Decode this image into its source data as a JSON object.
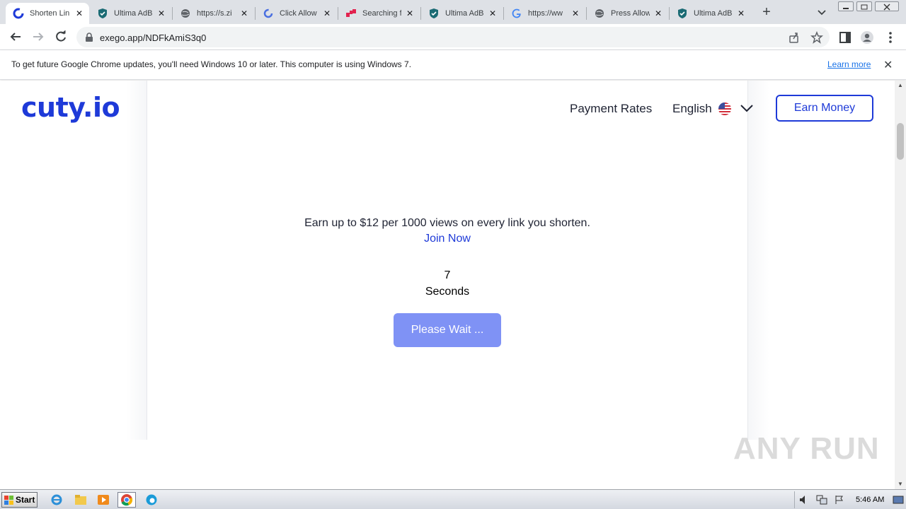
{
  "browser": {
    "tabs": [
      {
        "title": "Shorten Lin",
        "favicon": "cuty-icon",
        "active": true
      },
      {
        "title": "Ultima AdBl",
        "favicon": "shield-icon",
        "active": false
      },
      {
        "title": "https://s.zi",
        "favicon": "globe-icon",
        "active": false
      },
      {
        "title": "Click Allow",
        "favicon": "reload-favicon-icon",
        "active": false
      },
      {
        "title": "Searching f",
        "favicon": "squares-icon",
        "active": false
      },
      {
        "title": "Ultima AdBl",
        "favicon": "shield-icon",
        "active": false
      },
      {
        "title": "https://ww",
        "favicon": "google-icon",
        "active": false
      },
      {
        "title": "Press Allow",
        "favicon": "globe-icon",
        "active": false
      },
      {
        "title": "Ultima AdBl",
        "favicon": "shield-icon",
        "active": false
      }
    ],
    "url": "exego.app/NDFkAmiS3q0"
  },
  "infobar": {
    "message": "To get future Google Chrome updates, you'll need Windows 10 or later. This computer is using Windows 7.",
    "learn_more": "Learn more"
  },
  "site": {
    "logo": "cuty.io",
    "nav": {
      "payment_rates": "Payment Rates",
      "language": "English",
      "earn_money": "Earn Money"
    },
    "promo": "Earn up to $12 per 1000 views on every link you shorten.",
    "join_now": "Join Now",
    "countdown_value": "7",
    "countdown_unit": "Seconds",
    "wait_button": "Please Wait ..."
  },
  "watermark": "ANY RUN",
  "taskbar": {
    "start": "Start",
    "clock": "5:46 AM"
  },
  "colors": {
    "brand_blue": "#1e3ad8",
    "wait_button": "#7f92f5",
    "link_blue": "#1a73e8"
  }
}
